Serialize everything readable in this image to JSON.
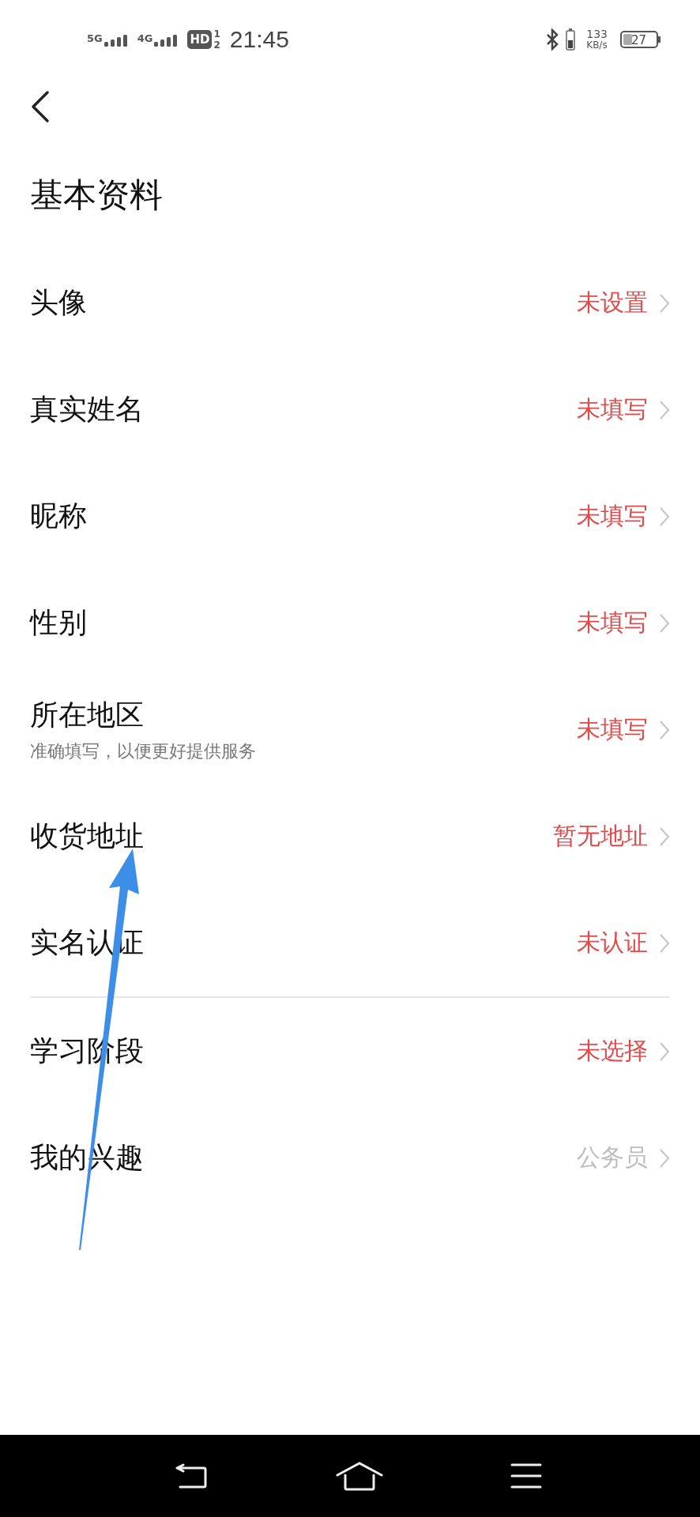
{
  "status_bar": {
    "sim_1": "5G",
    "sim_2": "4G",
    "hd": "HD",
    "hd_slots": [
      "1",
      "2"
    ],
    "time": "21:45",
    "speed": "133",
    "speed_unit": "KB/s",
    "battery": "27"
  },
  "title": "基本资料",
  "sections": [
    {
      "items": [
        {
          "label": "头像",
          "value": "未设置",
          "color": "#e24b4b"
        },
        {
          "label": "真实姓名",
          "value": "未填写",
          "color": "#e24b4b"
        },
        {
          "label": "昵称",
          "value": "未填写",
          "color": "#e24b4b"
        },
        {
          "label": "性别",
          "value": "未填写",
          "color": "#e24b4b"
        },
        {
          "label": "所在地区",
          "hint": "准确填写，以便更好提供服务",
          "value": "未填写",
          "color": "#e24b4b"
        },
        {
          "label": "收货地址",
          "value": "暂无地址",
          "color": "#e24b4b"
        },
        {
          "label": "实名认证",
          "value": "未认证",
          "color": "#e24b4b"
        }
      ]
    },
    {
      "items": [
        {
          "label": "学习阶段",
          "value": "未选择",
          "color": "#e24b4b"
        },
        {
          "label": "我的兴趣",
          "value": "公务员",
          "color": "#bdbdbd"
        }
      ]
    }
  ],
  "annotation": {
    "kind": "arrow",
    "color": "#3d8ee6"
  }
}
